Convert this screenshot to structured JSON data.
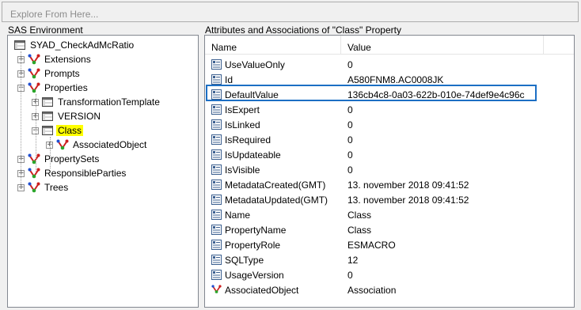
{
  "explore": {
    "placeholder": "Explore From Here..."
  },
  "left_pane": {
    "title": "SAS Environment",
    "tree": [
      {
        "label": "SYAD_CheckAdMcRatio",
        "icon": "table-icon",
        "toggle": "",
        "level": 0
      },
      {
        "label": "Extensions",
        "icon": "association-icon",
        "toggle": "+",
        "level": 1
      },
      {
        "label": "Prompts",
        "icon": "association-icon",
        "toggle": "+",
        "level": 1
      },
      {
        "label": "Properties",
        "icon": "association-icon",
        "toggle": "−",
        "level": 1
      },
      {
        "label": "TransformationTemplate",
        "icon": "table-icon",
        "toggle": "+",
        "level": 2
      },
      {
        "label": "VERSION",
        "icon": "table-icon",
        "toggle": "+",
        "level": 2
      },
      {
        "label": "Class",
        "icon": "table-icon",
        "toggle": "−",
        "level": 2,
        "selected": true
      },
      {
        "label": "AssociatedObject",
        "icon": "association-icon",
        "toggle": "+",
        "level": 3
      },
      {
        "label": "PropertySets",
        "icon": "association-icon",
        "toggle": "+",
        "level": 1
      },
      {
        "label": "ResponsibleParties",
        "icon": "association-icon",
        "toggle": "+",
        "level": 1
      },
      {
        "label": "Trees",
        "icon": "association-icon",
        "toggle": "+",
        "level": 1
      }
    ]
  },
  "right_pane": {
    "title": "Attributes and Associations of \"Class\" Property",
    "columns": {
      "name": "Name",
      "value": "Value"
    },
    "rows": [
      {
        "name": "UseValueOnly",
        "value": "0",
        "icon": "attribute-icon"
      },
      {
        "name": "Id",
        "value": "A580FNM8.AC0008JK",
        "icon": "attribute-icon"
      },
      {
        "name": "DefaultValue",
        "value": "136cb4c8-0a03-622b-010e-74def9e4c96c",
        "icon": "attribute-icon",
        "highlighted": true
      },
      {
        "name": "IsExpert",
        "value": "0",
        "icon": "attribute-icon"
      },
      {
        "name": "IsLinked",
        "value": "0",
        "icon": "attribute-icon"
      },
      {
        "name": "IsRequired",
        "value": "0",
        "icon": "attribute-icon"
      },
      {
        "name": "IsUpdateable",
        "value": "0",
        "icon": "attribute-icon"
      },
      {
        "name": "IsVisible",
        "value": "0",
        "icon": "attribute-icon"
      },
      {
        "name": "MetadataCreated(GMT)",
        "value": "13. november 2018 09:41:52",
        "icon": "attribute-icon"
      },
      {
        "name": "MetadataUpdated(GMT)",
        "value": "13. november 2018 09:41:52",
        "icon": "attribute-icon"
      },
      {
        "name": "Name",
        "value": "Class",
        "icon": "attribute-icon"
      },
      {
        "name": "PropertyName",
        "value": "Class",
        "icon": "attribute-icon"
      },
      {
        "name": "PropertyRole",
        "value": "ESMACRO",
        "icon": "attribute-icon"
      },
      {
        "name": "SQLType",
        "value": "12",
        "icon": "attribute-icon"
      },
      {
        "name": "UsageVersion",
        "value": "0",
        "icon": "attribute-icon"
      },
      {
        "name": "AssociatedObject",
        "value": "Association",
        "icon": "association-icon"
      }
    ]
  },
  "colors": {
    "selection_highlight": "#ffff00",
    "focus_box": "#1c6fc4",
    "association_red": "#cc1e1e",
    "association_green": "#2aa52a",
    "association_blue": "#1f4fd1"
  }
}
